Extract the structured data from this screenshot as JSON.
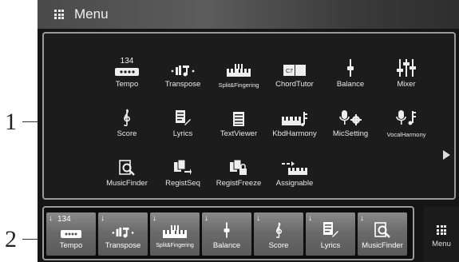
{
  "callouts": {
    "one": "1",
    "two": "2"
  },
  "header": {
    "title": "Menu",
    "icon": "grid-icon"
  },
  "menu_items": [
    {
      "label": "Tempo",
      "icon": "tempo-icon",
      "value": "134"
    },
    {
      "label": "Transpose",
      "icon": "transpose-icon"
    },
    {
      "label": "Split&Fingering",
      "icon": "split-fingering-icon"
    },
    {
      "label": "ChordTutor",
      "icon": "chord-tutor-icon",
      "badge": "C7"
    },
    {
      "label": "Balance",
      "icon": "balance-icon"
    },
    {
      "label": "Mixer",
      "icon": "mixer-icon"
    },
    {
      "label": "Score",
      "icon": "score-icon"
    },
    {
      "label": "Lyrics",
      "icon": "lyrics-icon"
    },
    {
      "label": "TextViewer",
      "icon": "text-viewer-icon"
    },
    {
      "label": "KbdHarmony",
      "icon": "kbd-harmony-icon"
    },
    {
      "label": "MicSetting",
      "icon": "mic-setting-icon"
    },
    {
      "label": "VocalHarmony",
      "icon": "vocal-harmony-icon"
    },
    {
      "label": "MusicFinder",
      "icon": "music-finder-icon"
    },
    {
      "label": "RegistSeq",
      "icon": "regist-seq-icon"
    },
    {
      "label": "RegistFreeze",
      "icon": "regist-freeze-icon"
    },
    {
      "label": "Assignable",
      "icon": "assignable-icon"
    }
  ],
  "shortcuts": [
    {
      "label": "Tempo",
      "icon": "tempo-icon",
      "value": "134"
    },
    {
      "label": "Transpose",
      "icon": "transpose-icon"
    },
    {
      "label": "Split&Fingering",
      "icon": "split-fingering-icon"
    },
    {
      "label": "Balance",
      "icon": "balance-icon"
    },
    {
      "label": "Score",
      "icon": "score-icon"
    },
    {
      "label": "Lyrics",
      "icon": "lyrics-icon"
    },
    {
      "label": "MusicFinder",
      "icon": "music-finder-icon"
    }
  ],
  "shortcut_arrow": "↓",
  "menu_button": {
    "label": "Menu",
    "icon": "grid-icon"
  },
  "colors": {
    "screen_bg": "#151515",
    "panel_border": "#9a9a9a",
    "button_bg": "#6a6a6a",
    "text": "#e8e8e8"
  }
}
